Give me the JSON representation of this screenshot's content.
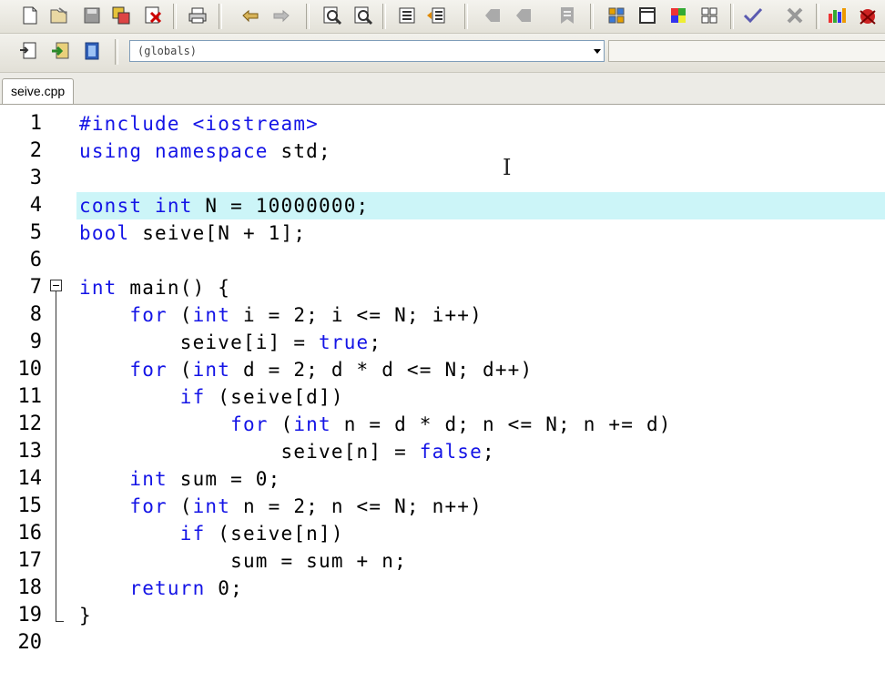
{
  "toolbar": {
    "row1_icons": [
      "new-file-icon",
      "open-file-icon",
      "save-file-icon",
      "save-all-icon",
      "close-file-icon",
      "print-icon",
      "undo-icon",
      "redo-icon",
      "find-icon",
      "replace-icon",
      "indent-icon",
      "unindent-icon",
      "bookmark-prev-icon",
      "bookmark-next-icon",
      "bookmark-toggle-icon",
      "project-view-icon",
      "class-view-icon",
      "toolbar-colors-icon",
      "grid-icon",
      "compile-check-icon",
      "stop-icon",
      "chart-icon",
      "debug-icon"
    ],
    "row2_icons": [
      "goto-icon",
      "insert-icon",
      "class-browser-icon"
    ],
    "scope_value": "(globals)",
    "member_value": ""
  },
  "tabs": [
    {
      "label": "seive.cpp",
      "active": true
    }
  ],
  "editor": {
    "highlighted_line": 4,
    "lines": [
      {
        "num": "1",
        "tokens": [
          {
            "t": "#include <iostream>",
            "c": "pp"
          }
        ]
      },
      {
        "num": "2",
        "tokens": [
          {
            "t": "using namespace",
            "c": "kw"
          },
          {
            "t": " std;",
            "c": ""
          }
        ]
      },
      {
        "num": "3",
        "tokens": []
      },
      {
        "num": "4",
        "tokens": [
          {
            "t": "const int",
            "c": "kw"
          },
          {
            "t": " N = 10000000;",
            "c": ""
          }
        ]
      },
      {
        "num": "5",
        "tokens": [
          {
            "t": "bool",
            "c": "kw"
          },
          {
            "t": " seive[N + 1];",
            "c": ""
          }
        ]
      },
      {
        "num": "6",
        "tokens": []
      },
      {
        "num": "7",
        "tokens": [
          {
            "t": "int",
            "c": "kw"
          },
          {
            "t": " main() {",
            "c": ""
          }
        ]
      },
      {
        "num": "8",
        "tokens": [
          {
            "t": "    ",
            "c": ""
          },
          {
            "t": "for",
            "c": "kw"
          },
          {
            "t": " (",
            "c": ""
          },
          {
            "t": "int",
            "c": "kw"
          },
          {
            "t": " i = 2; i <= N; i++)",
            "c": ""
          }
        ]
      },
      {
        "num": "9",
        "tokens": [
          {
            "t": "        seive[i] = ",
            "c": ""
          },
          {
            "t": "true",
            "c": "kw"
          },
          {
            "t": ";",
            "c": ""
          }
        ]
      },
      {
        "num": "10",
        "tokens": [
          {
            "t": "    ",
            "c": ""
          },
          {
            "t": "for",
            "c": "kw"
          },
          {
            "t": " (",
            "c": ""
          },
          {
            "t": "int",
            "c": "kw"
          },
          {
            "t": " d = 2; d * d <= N; d++)",
            "c": ""
          }
        ]
      },
      {
        "num": "11",
        "tokens": [
          {
            "t": "        ",
            "c": ""
          },
          {
            "t": "if",
            "c": "kw"
          },
          {
            "t": " (seive[d])",
            "c": ""
          }
        ]
      },
      {
        "num": "12",
        "tokens": [
          {
            "t": "            ",
            "c": ""
          },
          {
            "t": "for",
            "c": "kw"
          },
          {
            "t": " (",
            "c": ""
          },
          {
            "t": "int",
            "c": "kw"
          },
          {
            "t": " n = d * d; n <= N; n += d)",
            "c": ""
          }
        ]
      },
      {
        "num": "13",
        "tokens": [
          {
            "t": "                seive[n] = ",
            "c": ""
          },
          {
            "t": "false",
            "c": "kw"
          },
          {
            "t": ";",
            "c": ""
          }
        ]
      },
      {
        "num": "14",
        "tokens": [
          {
            "t": "    ",
            "c": ""
          },
          {
            "t": "int",
            "c": "kw"
          },
          {
            "t": " sum = 0;",
            "c": ""
          }
        ]
      },
      {
        "num": "15",
        "tokens": [
          {
            "t": "    ",
            "c": ""
          },
          {
            "t": "for",
            "c": "kw"
          },
          {
            "t": " (",
            "c": ""
          },
          {
            "t": "int",
            "c": "kw"
          },
          {
            "t": " n = 2; n <= N; n++)",
            "c": ""
          }
        ]
      },
      {
        "num": "16",
        "tokens": [
          {
            "t": "        ",
            "c": ""
          },
          {
            "t": "if",
            "c": "kw"
          },
          {
            "t": " (seive[n])",
            "c": ""
          }
        ]
      },
      {
        "num": "17",
        "tokens": [
          {
            "t": "            sum = sum + n;",
            "c": ""
          }
        ]
      },
      {
        "num": "18",
        "tokens": [
          {
            "t": "    ",
            "c": ""
          },
          {
            "t": "return",
            "c": "kw"
          },
          {
            "t": " 0;",
            "c": ""
          }
        ]
      },
      {
        "num": "19",
        "tokens": [
          {
            "t": "}",
            "c": ""
          }
        ]
      },
      {
        "num": "20",
        "tokens": []
      }
    ]
  },
  "colors": {
    "keyword": "#1414e6",
    "line_highlight": "#ccf5f8",
    "text": "#000000"
  }
}
